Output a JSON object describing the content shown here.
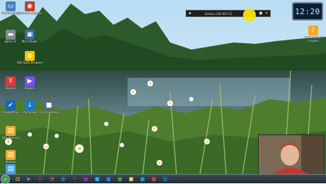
{
  "desktop": {
    "icons": [
      {
        "name": "computer",
        "label": "Компьютер",
        "icon": "computer-icon",
        "color": "#4a7fbf"
      },
      {
        "name": "quick-snapshot",
        "label": "Снимок экрана",
        "icon": "camera-icon",
        "color": "#c0392b"
      },
      {
        "name": "disk-d",
        "label": "Диск D:",
        "icon": "drive-icon",
        "color": "#7f8c8d"
      },
      {
        "name": "photo-app",
        "label": "ФотоЛайн",
        "icon": "photo-icon",
        "color": "#2c6aa8"
      },
      {
        "name": "360-browser",
        "label": "360 Safe Browser",
        "icon": "globe-icon",
        "color": "#f2c200"
      },
      {
        "name": "yandex",
        "label": "Яндекс",
        "icon": "yandex-icon",
        "color": "#e53935"
      },
      {
        "name": "video-app",
        "label": "Видео",
        "icon": "video-icon",
        "color": "#7c4dff"
      },
      {
        "name": "app-blue-1",
        "label": "Ускоритель",
        "icon": "gear-icon",
        "color": "#1565c0"
      },
      {
        "name": "app-blue-2",
        "label": "Загрузки",
        "icon": "download-icon",
        "color": "#1976d2"
      },
      {
        "name": "app-gray",
        "label": "Программы",
        "icon": "app-icon",
        "color": "#546e7a"
      },
      {
        "name": "folder-1",
        "label": "Документы",
        "icon": "folder-icon",
        "color": "#f9a825"
      },
      {
        "name": "folder-2",
        "label": "Файлы",
        "icon": "folder-icon",
        "color": "#f9a825"
      },
      {
        "name": "media-folder",
        "label": "Медиа",
        "icon": "folder-icon",
        "color": "#42a5f5"
      }
    ],
    "right_icon": {
      "label": "музыкальн студия",
      "icon": "music-folder-icon"
    }
  },
  "recorder": {
    "title": "Запись [00:00:11]",
    "icons": [
      "pencil-icon",
      "camera-icon",
      "close-icon"
    ]
  },
  "clock": {
    "time": "12:20"
  },
  "taskbar": {
    "items": [
      {
        "name": "explorer",
        "icon": "folder-icon",
        "color": "#f9a825"
      },
      {
        "name": "media",
        "icon": "video-icon",
        "color": "#7f8c8d"
      },
      {
        "name": "opera",
        "icon": "opera-icon",
        "color": "#e53935"
      },
      {
        "name": "firefox",
        "icon": "firefox-icon",
        "color": "#ff7043"
      },
      {
        "name": "browser",
        "icon": "globe-icon",
        "color": "#42a5f5"
      },
      {
        "name": "yandex",
        "icon": "yandex-icon",
        "color": "#e53935"
      },
      {
        "name": "app-7",
        "icon": "app-icon",
        "color": "#9c27b0"
      },
      {
        "name": "app-8",
        "icon": "app-icon",
        "color": "#29b6f6"
      },
      {
        "name": "app-9",
        "icon": "app-icon",
        "color": "#1e88e5"
      },
      {
        "name": "app-10",
        "icon": "app-icon",
        "color": "#43a047"
      },
      {
        "name": "app-11",
        "icon": "app-icon",
        "color": "#fdd835"
      },
      {
        "name": "app-12",
        "icon": "app-icon",
        "color": "#00acc1"
      },
      {
        "name": "app-13",
        "icon": "app-icon",
        "color": "#e53935"
      },
      {
        "name": "app-14",
        "icon": "app-icon",
        "color": "#1565c0"
      }
    ]
  }
}
